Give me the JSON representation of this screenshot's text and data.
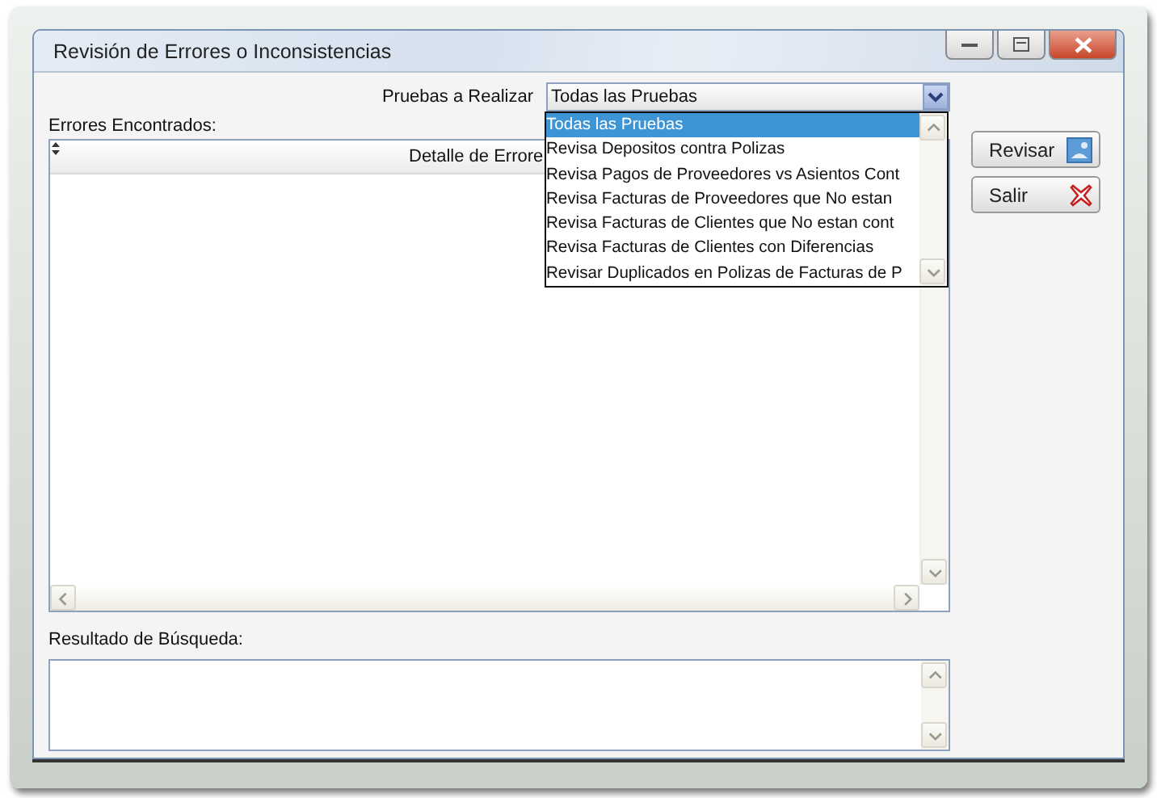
{
  "window": {
    "title": "Revisión de Errores o Inconsistencias"
  },
  "tests": {
    "label": "Pruebas a Realizar",
    "value": "Todas las Pruebas",
    "expanded": true,
    "options": [
      {
        "label": "Todas las Pruebas",
        "selected": true
      },
      {
        "label": "Revisa Depositos contra Polizas",
        "selected": false
      },
      {
        "label": "Revisa Pagos de Proveedores vs Asientos Cont",
        "selected": false
      },
      {
        "label": "Revisa Facturas de Proveedores que No estan",
        "selected": false
      },
      {
        "label": "Revisa Facturas de Clientes que No estan cont",
        "selected": false
      },
      {
        "label": "Revisa Facturas de Clientes con Diferencias",
        "selected": false
      },
      {
        "label": "Revisar Duplicados en Polizas de Facturas de P",
        "selected": false
      }
    ]
  },
  "errors": {
    "label": "Errores Encontrados:",
    "columns": [
      "Detalle de Errore"
    ]
  },
  "result": {
    "label": "Resultado de Búsqueda:"
  },
  "buttons": [
    {
      "label": "Revisar",
      "kind": "review"
    },
    {
      "label": "Salir",
      "kind": "exit"
    }
  ]
}
